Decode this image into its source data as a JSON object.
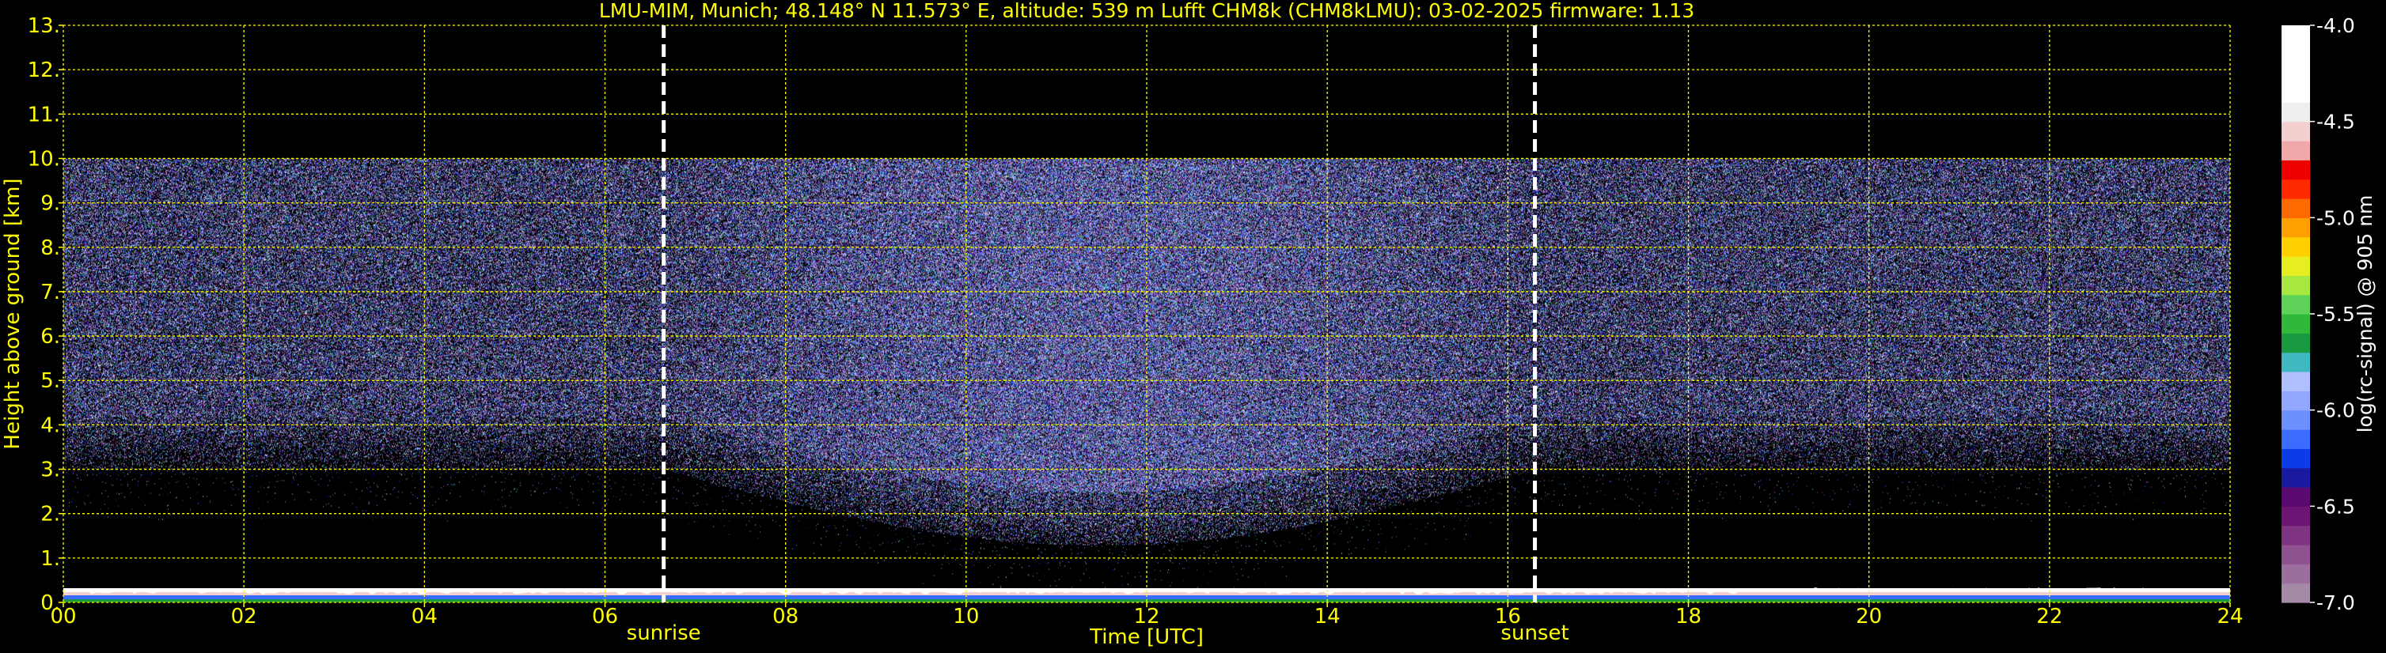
{
  "chart_data": {
    "type": "heatmap",
    "title": "LMU-MIM, Munich; 48.148° N 11.573° E, altitude: 539 m    Lufft CHM8k (CHM8kLMU): 03-02-2025    firmware: 1.13",
    "xlabel": "Time [UTC]",
    "ylabel": "Height above ground [km]",
    "xlim": [
      0,
      24
    ],
    "ylim": [
      0,
      13
    ],
    "x_ticks": [
      0,
      2,
      4,
      6,
      8,
      10,
      12,
      14,
      16,
      18,
      20,
      22,
      24
    ],
    "x_tick_labels": [
      "00",
      "02",
      "04",
      "06",
      "08",
      "10",
      "12",
      "14",
      "16",
      "18",
      "20",
      "22",
      "24"
    ],
    "y_ticks": [
      0,
      1,
      2,
      3,
      4,
      5,
      6,
      7,
      8,
      9,
      10,
      11,
      12,
      13
    ],
    "y_tick_labels": [
      "0.",
      "1.",
      "2.",
      "3.",
      "4.",
      "5.",
      "6.",
      "7.",
      "8.",
      "9.",
      "10.",
      "11.",
      "12.",
      "13."
    ],
    "grid": true,
    "grid_color": "#ffff00",
    "text_color": "#ffff00",
    "background": "#000000",
    "annotations": [
      {
        "label": "sunrise",
        "x": 6.65
      },
      {
        "label": "sunset",
        "x": 16.3
      }
    ],
    "data_ceiling_km": 10.0,
    "surface_layer_top_km": 0.25,
    "noise_floor_km": {
      "night": 3.0,
      "midday": 1.3
    },
    "colorbar": {
      "label": "log(rc-signal) @ 905 nm",
      "range": [
        -7.0,
        -4.0
      ],
      "ticks": [
        -7.0,
        -6.5,
        -6.0,
        -5.5,
        -5.0,
        -4.5,
        -4.0
      ],
      "tick_labels": [
        "-7.0",
        "-6.5",
        "-6.0",
        "-5.5",
        "-5.0",
        "-4.5",
        "-4.0"
      ],
      "colors": [
        "#a58aa8",
        "#9c6e9e",
        "#8f5290",
        "#803583",
        "#6e1475",
        "#5a0a70",
        "#1a1aa0",
        "#0b3ce8",
        "#3a6cff",
        "#6d90ff",
        "#92a8ff",
        "#b0c0ff",
        "#3fb8c0",
        "#1a9a40",
        "#2fb83a",
        "#5fd25a",
        "#a6e840",
        "#e6ee20",
        "#ffd000",
        "#ffa000",
        "#ff6a00",
        "#ff2a00",
        "#ee0000",
        "#f0a8a8",
        "#f3cfcf",
        "#eeeeee",
        "#ffffff",
        "#ffffff",
        "#ffffff",
        "#ffffff"
      ]
    }
  }
}
